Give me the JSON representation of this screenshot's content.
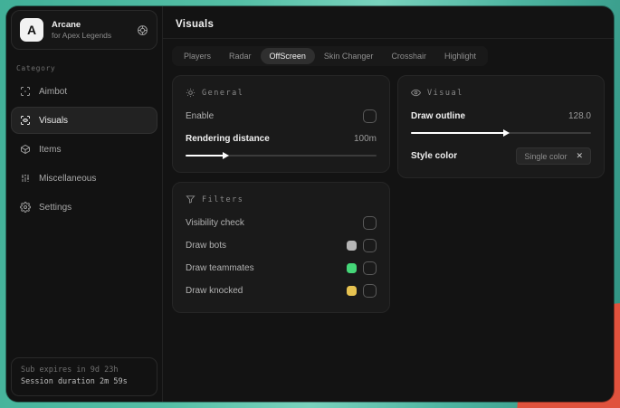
{
  "background": {
    "teal": "#55bfa6",
    "orange": "#e0523d"
  },
  "sidebar": {
    "app": {
      "initial": "A",
      "name": "Arcane",
      "subtitle": "for Apex Legends"
    },
    "category_label": "Category",
    "items": [
      {
        "label": "Aimbot",
        "icon": "crosshair-icon",
        "active": false
      },
      {
        "label": "Visuals",
        "icon": "eye-scan-icon",
        "active": true
      },
      {
        "label": "Items",
        "icon": "cube-icon",
        "active": false
      },
      {
        "label": "Miscellaneous",
        "icon": "sliders-icon",
        "active": false
      },
      {
        "label": "Settings",
        "icon": "gear-icon",
        "active": false
      }
    ],
    "footer": {
      "line1": "Sub expires in 9d 23h",
      "line2": "Session duration 2m 59s"
    }
  },
  "main": {
    "title": "Visuals",
    "tabs": [
      {
        "label": "Players",
        "active": false
      },
      {
        "label": "Radar",
        "active": false
      },
      {
        "label": "OffScreen",
        "active": true
      },
      {
        "label": "Skin Changer",
        "active": false
      },
      {
        "label": "Crosshair",
        "active": false
      },
      {
        "label": "Highlight",
        "active": false
      }
    ],
    "panels": {
      "general": {
        "title": "General",
        "enable_label": "Enable",
        "enable_checked": false,
        "rendering_distance_label": "Rendering distance",
        "rendering_distance_value": "100m",
        "rendering_distance_percent": 20
      },
      "visual": {
        "title": "Visual",
        "draw_outline_label": "Draw outline",
        "draw_outline_value": "128.0",
        "draw_outline_percent": 52,
        "style_color_label": "Style color",
        "style_color_value": "Single color"
      },
      "filters": {
        "title": "Filters",
        "rows": [
          {
            "label": "Visibility check",
            "swatch": null,
            "checked": false
          },
          {
            "label": "Draw bots",
            "swatch": "#b5b5b5",
            "checked": false
          },
          {
            "label": "Draw teammates",
            "swatch": "#45d678",
            "checked": false
          },
          {
            "label": "Draw knocked",
            "swatch": "#e6c250",
            "checked": false
          }
        ]
      }
    }
  }
}
